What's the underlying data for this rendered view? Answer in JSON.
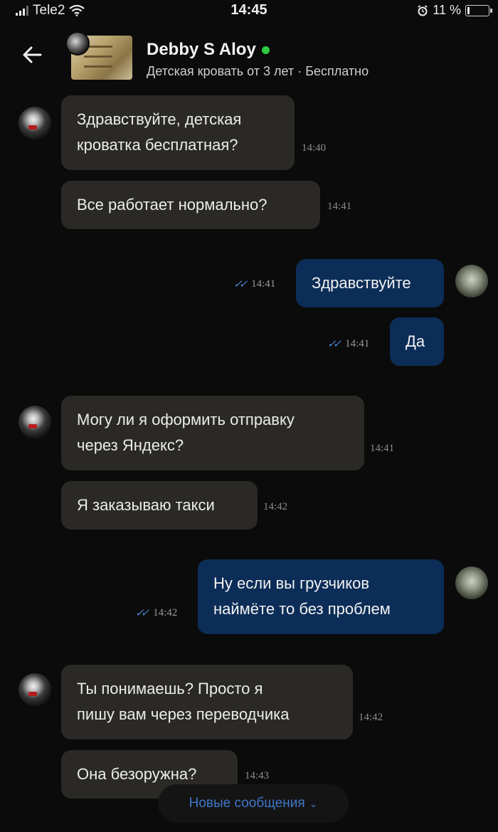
{
  "status_bar": {
    "carrier": "Tele2",
    "time": "14:45",
    "battery": "11 %"
  },
  "header": {
    "seller_name": "Debby S Aloy",
    "listing": "Детская кровать от 3 лет · Бесплатно",
    "online_color": "#2ecc40"
  },
  "messages": [
    {
      "dir": "in",
      "text": "Здравствуйте, детская\nкроватка бесплатная?",
      "time": "14:40"
    },
    {
      "dir": "in",
      "text": "Все работает нормально?",
      "time": "14:41"
    },
    {
      "dir": "out",
      "text": "Здравствуйте",
      "time": "14:41"
    },
    {
      "dir": "out",
      "text": "Да",
      "time": "14:41"
    },
    {
      "dir": "in",
      "text": "Могу ли я оформить отправку\nчерез Яндекс?",
      "time": "14:41"
    },
    {
      "dir": "in",
      "text": "Я заказываю такси",
      "time": "14:42"
    },
    {
      "dir": "out",
      "text": "Ну если вы грузчиков\nнаймёте то без проблем",
      "time": "14:42"
    },
    {
      "dir": "in",
      "text": "Ты понимаешь? Просто я\nпишу вам через переводчика",
      "time": "14:42"
    },
    {
      "dir": "in",
      "text": "Она безоружна?",
      "time": "14:43"
    }
  ],
  "new_messages_label": "Новые сообщения",
  "colors": {
    "background": "#0b0b0b",
    "incoming_bubble": "#2b2926",
    "outgoing_bubble": "#0c2d57",
    "read_ticks": "#4a8ad8",
    "link_blue": "#3f78c9"
  },
  "icons": {
    "back": "arrow-left-icon",
    "wifi": "wifi-icon",
    "alarm": "alarm-icon",
    "read_status": "double-check-icon",
    "chevron": "chevron-down-icon"
  }
}
